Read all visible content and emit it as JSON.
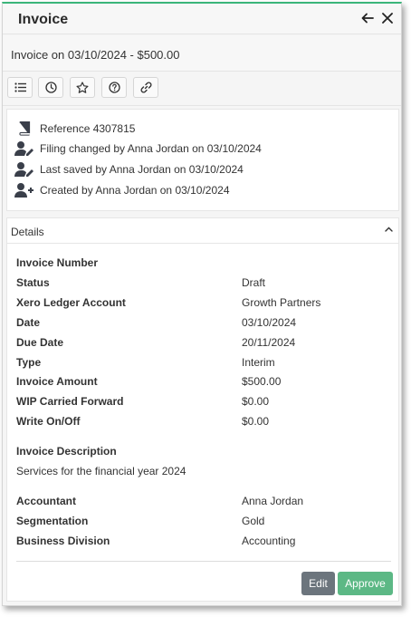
{
  "window": {
    "title": "Invoice",
    "back_icon": "arrow-left-icon",
    "close_icon": "close-icon"
  },
  "subtitle": "Invoice on 03/10/2024 - $500.00",
  "toolbar": {
    "buttons": [
      {
        "name": "list-icon"
      },
      {
        "name": "clock-icon"
      },
      {
        "name": "star-icon"
      },
      {
        "name": "help-icon"
      },
      {
        "name": "link-icon"
      }
    ]
  },
  "history": [
    {
      "icon": "book-icon",
      "text": "Reference 4307815"
    },
    {
      "icon": "user-edit-icon",
      "text": "Filing changed by Anna Jordan on 03/10/2024"
    },
    {
      "icon": "user-edit-icon",
      "text": "Last saved by Anna Jordan on 03/10/2024"
    },
    {
      "icon": "user-add-icon",
      "text": "Created by Anna Jordan on 03/10/2024"
    }
  ],
  "details": {
    "header": "Details",
    "fields": [
      {
        "label": "Invoice Number",
        "value": ""
      },
      {
        "label": "Status",
        "value": "Draft"
      },
      {
        "label": "Xero Ledger Account",
        "value": "Growth Partners"
      },
      {
        "label": "Date",
        "value": "03/10/2024"
      },
      {
        "label": "Due Date",
        "value": "20/11/2024"
      },
      {
        "label": "Type",
        "value": "Interim"
      },
      {
        "label": "Invoice Amount",
        "value": "$500.00"
      },
      {
        "label": "WIP Carried Forward",
        "value": "$0.00"
      },
      {
        "label": "Write On/Off",
        "value": "$0.00"
      }
    ],
    "description_label": "Invoice Description",
    "description_value": "Services for the financial year  2024",
    "extra_fields": [
      {
        "label": "Accountant",
        "value": "Anna Jordan"
      },
      {
        "label": "Segmentation",
        "value": "Gold"
      },
      {
        "label": "Business Division",
        "value": "Accounting"
      }
    ]
  },
  "actions": {
    "edit_label": "Edit",
    "approve_label": "Approve"
  },
  "colors": {
    "accent": "#3bb57a",
    "approve": "#5cb885",
    "edit": "#6c757d"
  }
}
